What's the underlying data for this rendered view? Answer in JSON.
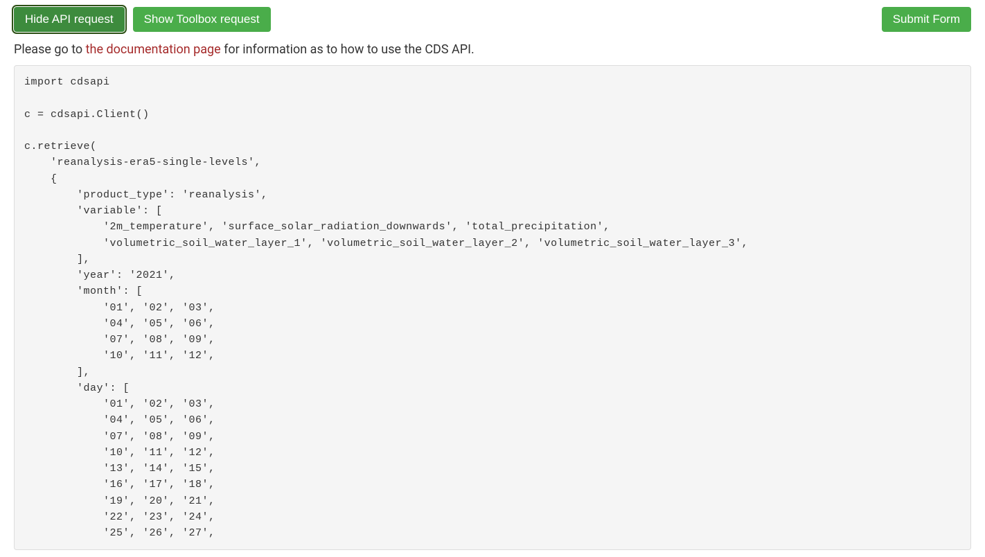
{
  "buttons": {
    "hide_api": "Hide API request",
    "show_toolbox": "Show Toolbox request",
    "submit_form": "Submit Form"
  },
  "info": {
    "prefix": "Please go to ",
    "link_text": "the documentation page",
    "suffix": " for information as to how to use the CDS API."
  },
  "code": "import cdsapi\n\nc = cdsapi.Client()\n\nc.retrieve(\n    'reanalysis-era5-single-levels',\n    {\n        'product_type': 'reanalysis',\n        'variable': [\n            '2m_temperature', 'surface_solar_radiation_downwards', 'total_precipitation',\n            'volumetric_soil_water_layer_1', 'volumetric_soil_water_layer_2', 'volumetric_soil_water_layer_3',\n        ],\n        'year': '2021',\n        'month': [\n            '01', '02', '03',\n            '04', '05', '06',\n            '07', '08', '09',\n            '10', '11', '12',\n        ],\n        'day': [\n            '01', '02', '03',\n            '04', '05', '06',\n            '07', '08', '09',\n            '10', '11', '12',\n            '13', '14', '15',\n            '16', '17', '18',\n            '19', '20', '21',\n            '22', '23', '24',\n            '25', '26', '27',"
}
